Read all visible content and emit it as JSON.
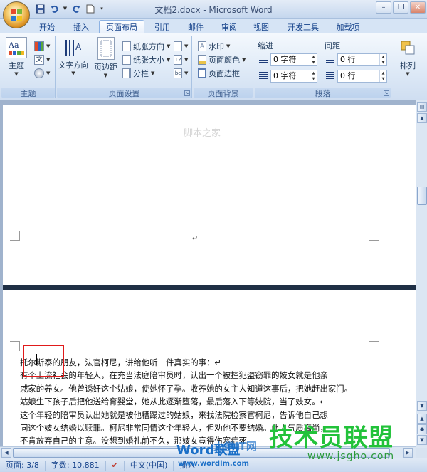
{
  "window": {
    "title": "文档2.docx - Microsoft Word",
    "controls": {
      "minimize": "–",
      "maximize": "❐",
      "close": "✕"
    }
  },
  "quick_access": {
    "save": "save-icon",
    "undo": "undo-icon",
    "redo": "redo-icon",
    "new": "new-doc-icon"
  },
  "tabs": [
    {
      "label": "开始",
      "active": false
    },
    {
      "label": "插入",
      "active": false
    },
    {
      "label": "页面布局",
      "active": true
    },
    {
      "label": "引用",
      "active": false
    },
    {
      "label": "邮件",
      "active": false
    },
    {
      "label": "审阅",
      "active": false
    },
    {
      "label": "视图",
      "active": false
    },
    {
      "label": "开发工具",
      "active": false
    },
    {
      "label": "加载项",
      "active": false
    }
  ],
  "ribbon": {
    "theme_group": {
      "label": "主题",
      "theme_button": "主题"
    },
    "page_setup": {
      "label": "页面设置",
      "text_direction": "文字方向",
      "margins": "页边距",
      "orientation": "纸张方向",
      "size": "纸张大小",
      "columns": "分栏"
    },
    "page_background": {
      "label": "页面背景",
      "watermark": "水印",
      "page_color": "页面颜色",
      "page_borders": "页面边框"
    },
    "paragraph": {
      "label": "段落",
      "indent_label": "缩进",
      "spacing_label": "间距",
      "indent_left": "0 字符",
      "indent_right": "0 字符",
      "spacing_before": "0 行",
      "spacing_after": "0 行"
    },
    "arrange": {
      "label": "排列"
    }
  },
  "document": {
    "paragraph_mark": "↵",
    "lines": [
      "托尔斯泰的朋友，法官柯尼，讲给他听一件真实的事：↵",
      "    有个上流社会的年轻人，在充当法庭陪审员时，认出一个被控犯盗窃罪的妓女就是他亲",
      "戚家的养女。他曾诱奸这个姑娘，使她怀了孕。收养她的女主人知道这事后，把她赶出家门。",
      "姑娘生下孩子后把他送给育婴堂，她从此逐渐堕落，最后落入下等妓院，当了妓女。↵",
      "    这个年轻的陪审员认出她就是被他糟蹋过的姑娘，来找法院检察官柯尼，告诉他自己想",
      "同这个妓女结婚以赎罪。柯尼非常同情这个年轻人，但劝他不要结婚。此人气质高尚，",
      "不肯放弃自己的主意。没想到婚礼前不久，那妓女竟得伤寒症死"
    ]
  },
  "statusbar": {
    "page": "页面: 3/8",
    "words": "字数: 10,881",
    "language": "中文(中国)",
    "insert_mode": "插入"
  },
  "watermarks": {
    "top": "脚本之家",
    "brand_cn": "技术员联盟",
    "brand_url": "www.jsgho.com",
    "brand_word": "Word联盟",
    "brand_word_url": "www.wordlm.com",
    "brand_it": "大学IT网"
  }
}
